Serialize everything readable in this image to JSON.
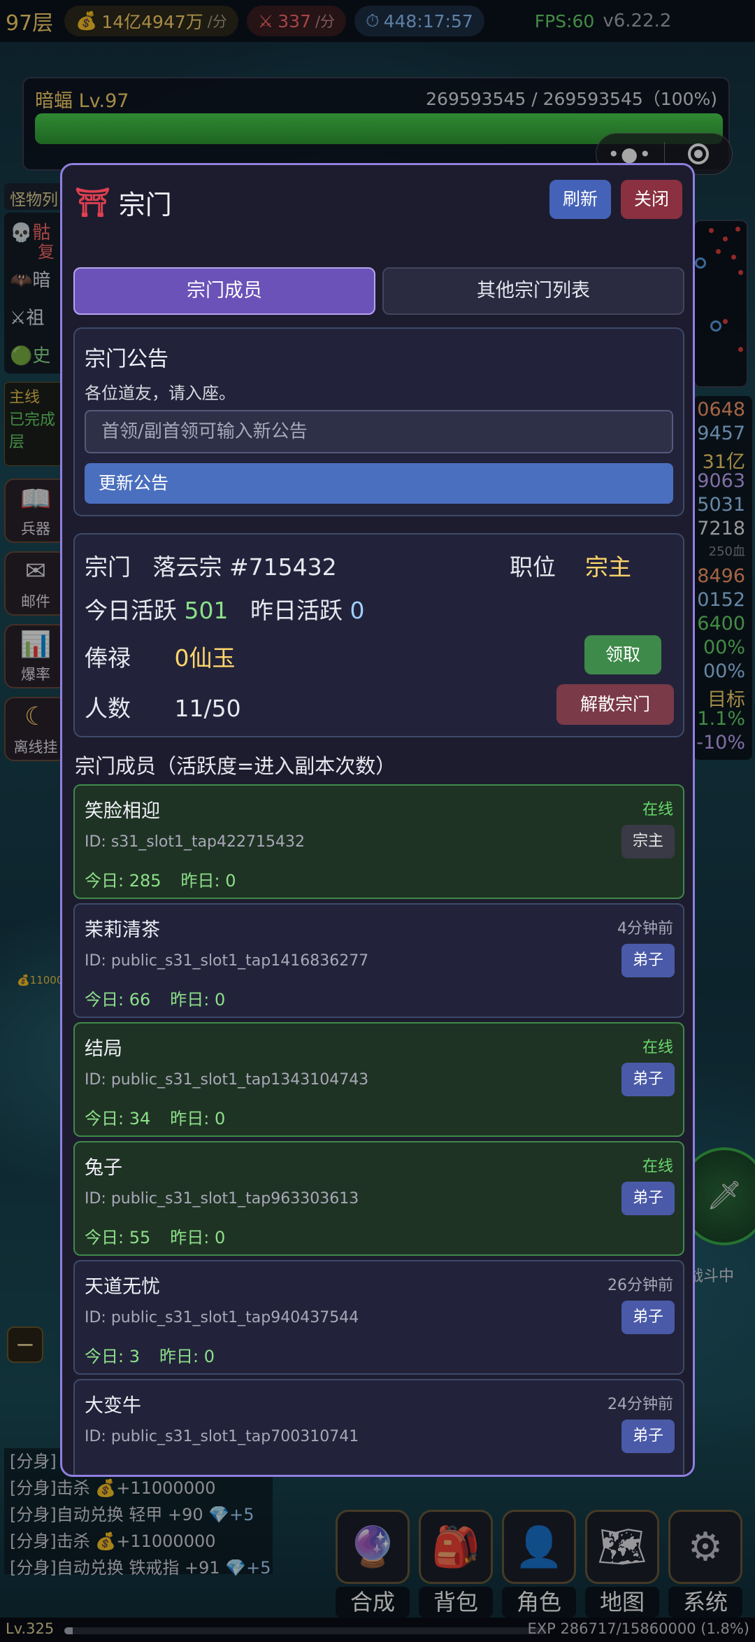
{
  "topbar": {
    "floor": "97层",
    "gold_rate": "14亿4947万",
    "gold_unit": "/分",
    "kill_rate": "337",
    "kill_unit": "/分",
    "timer": "448:17:57",
    "fps": "FPS:60",
    "version": "v6.22.2"
  },
  "enemy": {
    "name": "暗蝠 Lv.97",
    "hp_text": "269593545 / 269593545（100%)",
    "hp_fraction": 1.0
  },
  "capsule": {
    "more_icon": "more-dots-icon",
    "close_icon": "target-icon"
  },
  "left_panel": {
    "tab_label": "怪物列",
    "monsters": [
      "骷",
      "复",
      "暗",
      "祖",
      "史"
    ],
    "quest_text": [
      "主线",
      "已完成",
      "层"
    ],
    "side_buttons": [
      {
        "icon": "book-icon",
        "glyph": "📖",
        "label": "兵器"
      },
      {
        "icon": "mail-icon",
        "glyph": "✉",
        "label": "邮件"
      },
      {
        "icon": "chart-icon",
        "glyph": "📊",
        "label": "爆率"
      },
      {
        "icon": "moon-icon",
        "glyph": "☾",
        "label": "离线挂"
      }
    ],
    "minus_label": "−",
    "coin_float": "💰11000"
  },
  "right_panel": {
    "stats": [
      {
        "text": "0648",
        "color": "#ff9a6b"
      },
      {
        "text": "9457",
        "color": "#9ed0ff"
      },
      {
        "text": "31亿",
        "color": "#ffd66b"
      },
      {
        "text": "9063",
        "color": "#c8a8ff"
      },
      {
        "text": "5031",
        "color": "#9ed0ff"
      },
      {
        "text": "7218",
        "color": "#e8e8e8"
      },
      {
        "text": "250血",
        "color": "#888898"
      },
      {
        "text": "8496",
        "color": "#ff9a6b"
      },
      {
        "text": "0152",
        "color": "#9ed0ff"
      },
      {
        "text": "6400",
        "color": "#67d86a"
      },
      {
        "text": "00%",
        "color": "#67d86a"
      },
      {
        "text": "00%",
        "color": "#9ed0ff"
      },
      {
        "text": "目标",
        "color": "#ffd66b"
      },
      {
        "text": "1.1%",
        "color": "#67d86a"
      },
      {
        "text": "-10%",
        "color": "#c8a8ff"
      }
    ],
    "battle_label": "战斗中"
  },
  "log": [
    {
      "prefix": "[分身]",
      "text": "",
      "suffix": ""
    },
    {
      "prefix": "[分身]",
      "text": "击杀 💰+11000000",
      "suffix": ""
    },
    {
      "prefix": "[分身]",
      "text": "自动兑换 轻甲 +90 ",
      "suffix": "💎+5"
    },
    {
      "prefix": "[分身]",
      "text": "击杀 💰+11000000",
      "suffix": ""
    },
    {
      "prefix": "[分身]",
      "text": "自动兑换 铁戒指 +91 ",
      "suffix": "💎+5"
    }
  ],
  "actions": [
    {
      "icon": "crystal-ball-icon",
      "glyph": "🔮",
      "label": "合成"
    },
    {
      "icon": "backpack-icon",
      "glyph": "🎒",
      "label": "背包"
    },
    {
      "icon": "character-icon",
      "glyph": "👤",
      "label": "角色"
    },
    {
      "icon": "map-icon",
      "glyph": "🗺",
      "label": "地图"
    },
    {
      "icon": "gear-icon",
      "glyph": "⚙",
      "label": "系统"
    }
  ],
  "expbar": {
    "level": "Lv.325",
    "exp_text": "EXP 286717/15860000 (1.8%)",
    "exp_fraction": 0.018
  },
  "sect": {
    "title": "宗门",
    "title_icon": "torii-icon",
    "refresh_label": "刷新",
    "close_label": "关闭",
    "tabs": {
      "members": "宗门成员",
      "other": "其他宗门列表"
    },
    "notice": {
      "heading": "宗门公告",
      "content": "各位道友，请入座。",
      "input_placeholder": "首领/副首领可输入新公告",
      "update_label": "更新公告"
    },
    "info": {
      "sect_label": "宗门",
      "sect_name": "落云宗 #715432",
      "position_label": "职位",
      "position_value": "宗主",
      "today_label": "今日活跃",
      "today_value": "501",
      "yesterday_label": "昨日活跃",
      "yesterday_value": "0",
      "salary_label": "俸禄",
      "salary_value": "0仙玉",
      "claim_label": "领取",
      "count_label": "人数",
      "count_value": "11/50",
      "disband_label": "解散宗门"
    },
    "members_title": "宗门成员（活跃度=进入副本次数）",
    "members": [
      {
        "name": "笑脸相迎",
        "status": "在线",
        "online": true,
        "id": "ID: s31_slot1_tap422715432",
        "rank": "宗主",
        "today": "今日: 285",
        "yesterday": "昨日: 0"
      },
      {
        "name": "茉莉清茶",
        "status": "4分钟前",
        "online": false,
        "id": "ID: public_s31_slot1_tap1416836277",
        "rank": "弟子",
        "today": "今日: 66",
        "yesterday": "昨日: 0"
      },
      {
        "name": "结局",
        "status": "在线",
        "online": true,
        "id": "ID: public_s31_slot1_tap1343104743",
        "rank": "弟子",
        "today": "今日: 34",
        "yesterday": "昨日: 0"
      },
      {
        "name": "兔子",
        "status": "在线",
        "online": true,
        "id": "ID: public_s31_slot1_tap963303613",
        "rank": "弟子",
        "today": "今日: 55",
        "yesterday": "昨日: 0"
      },
      {
        "name": "天道无忧",
        "status": "26分钟前",
        "online": false,
        "id": "ID: public_s31_slot1_tap940437544",
        "rank": "弟子",
        "today": "今日: 3",
        "yesterday": "昨日: 0"
      },
      {
        "name": "大变牛",
        "status": "24分钟前",
        "online": false,
        "id": "ID: public_s31_slot1_tap700310741",
        "rank": "弟子",
        "today": "",
        "yesterday": ""
      }
    ]
  }
}
